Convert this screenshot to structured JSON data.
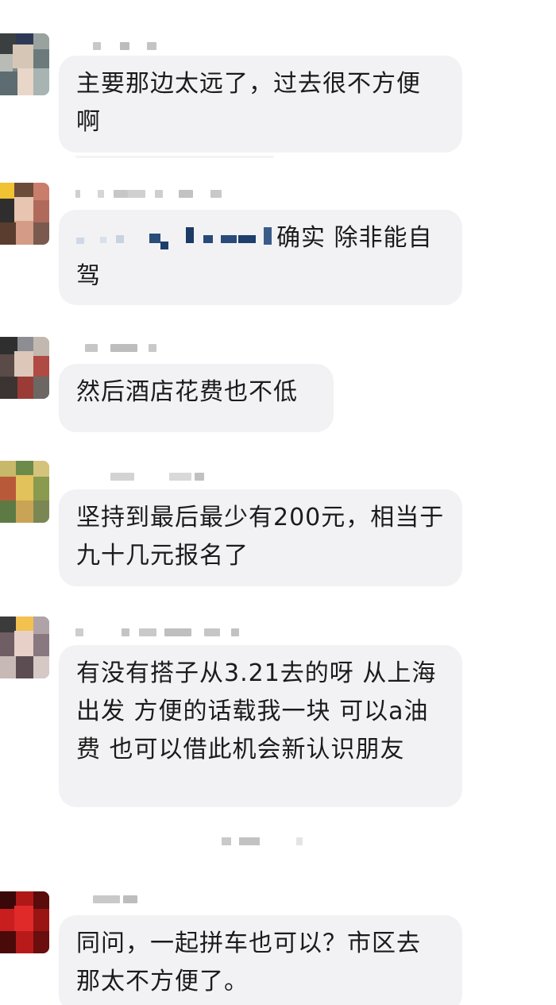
{
  "messages": [
    {
      "text": "主要那边太远了，过去很不方便啊"
    },
    {
      "text_before": "",
      "text_after": "确实 除非能自驾"
    },
    {
      "text": "然后酒店花费也不低"
    },
    {
      "text": "坚持到最后最少有200元，相当于九十几元报名了"
    },
    {
      "text": "有没有搭子从3.21去的呀 从上海出发 方便的话载我一块 可以a油费 也可以借此机会新认识朋友"
    },
    {
      "text": "同问，一起拼车也可以？市区去那太不方便了。"
    }
  ],
  "colors": {
    "bubble": "#f2f2f4",
    "text": "#1b1b1b",
    "background": "#ffffff"
  }
}
